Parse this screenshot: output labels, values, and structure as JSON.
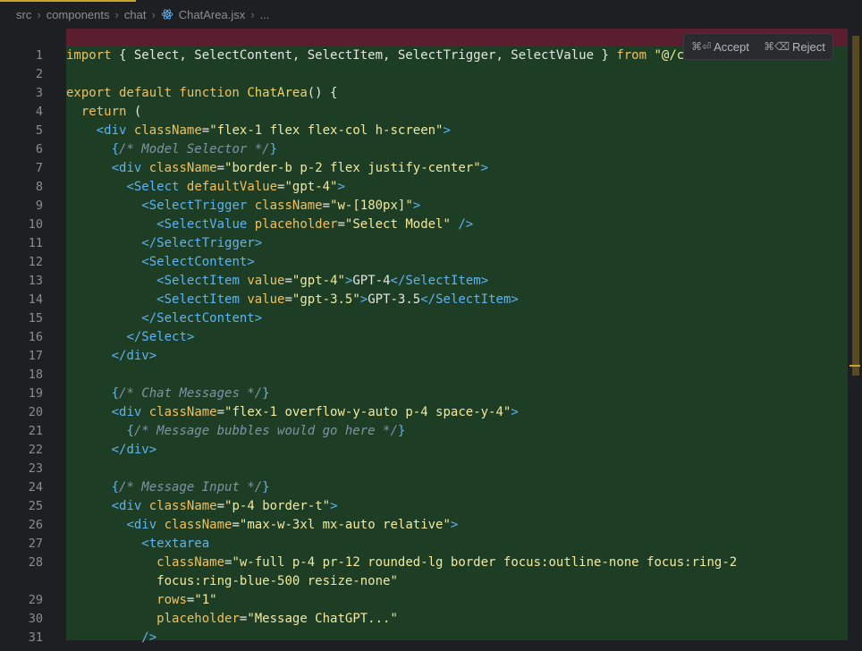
{
  "breadcrumb": {
    "items": [
      "src",
      "components",
      "chat",
      "ChatArea.jsx",
      "..."
    ]
  },
  "diff_actions": {
    "accept_key": "⌘⏎",
    "accept_label": "Accept",
    "reject_key": "⌘⌫",
    "reject_label": "Reject"
  },
  "colors": {
    "added_background": "#1d3d24",
    "deleted_background": "#5a1e2e",
    "keyword": "#f0c060",
    "tag": "#5fb3f0",
    "string": "#f2e9a0",
    "comment": "#7f94a6",
    "accent": "#c9a227"
  },
  "code": {
    "lines": [
      {
        "num": "1",
        "tokens": [
          [
            "kw",
            "import"
          ],
          [
            "txt",
            " { Select, SelectContent, SelectItem, SelectTrigger, SelectValue } "
          ],
          [
            "kw",
            "from"
          ],
          [
            "txt",
            " "
          ],
          [
            "str",
            "\"@/c"
          ]
        ]
      },
      {
        "num": "2",
        "tokens": []
      },
      {
        "num": "3",
        "tokens": [
          [
            "kw",
            "export default function"
          ],
          [
            "txt",
            " "
          ],
          [
            "fn",
            "ChatArea"
          ],
          [
            "txt",
            "() {"
          ]
        ]
      },
      {
        "num": "4",
        "tokens": [
          [
            "txt",
            "  "
          ],
          [
            "kw",
            "return"
          ],
          [
            "txt",
            " ("
          ]
        ]
      },
      {
        "num": "5",
        "tokens": [
          [
            "txt",
            "    "
          ],
          [
            "br",
            "<"
          ],
          [
            "tag",
            "div"
          ],
          [
            "txt",
            " "
          ],
          [
            "attr",
            "className"
          ],
          [
            "txt",
            "="
          ],
          [
            "str",
            "\"flex-1 flex flex-col h-screen\""
          ],
          [
            "br",
            ">"
          ]
        ]
      },
      {
        "num": "6",
        "tokens": [
          [
            "txt",
            "      "
          ],
          [
            "br",
            "{"
          ],
          [
            "cm",
            "/* Model Selector */"
          ],
          [
            "br",
            "}"
          ]
        ]
      },
      {
        "num": "7",
        "tokens": [
          [
            "txt",
            "      "
          ],
          [
            "br",
            "<"
          ],
          [
            "tag",
            "div"
          ],
          [
            "txt",
            " "
          ],
          [
            "attr",
            "className"
          ],
          [
            "txt",
            "="
          ],
          [
            "str",
            "\"border-b p-2 flex justify-center\""
          ],
          [
            "br",
            ">"
          ]
        ]
      },
      {
        "num": "8",
        "tokens": [
          [
            "txt",
            "        "
          ],
          [
            "br",
            "<"
          ],
          [
            "tag",
            "Select"
          ],
          [
            "txt",
            " "
          ],
          [
            "attr",
            "defaultValue"
          ],
          [
            "txt",
            "="
          ],
          [
            "str",
            "\"gpt-4\""
          ],
          [
            "br",
            ">"
          ]
        ]
      },
      {
        "num": "9",
        "tokens": [
          [
            "txt",
            "          "
          ],
          [
            "br",
            "<"
          ],
          [
            "tag",
            "SelectTrigger"
          ],
          [
            "txt",
            " "
          ],
          [
            "attr",
            "className"
          ],
          [
            "txt",
            "="
          ],
          [
            "str",
            "\"w-[180px]\""
          ],
          [
            "br",
            ">"
          ]
        ]
      },
      {
        "num": "10",
        "tokens": [
          [
            "txt",
            "            "
          ],
          [
            "br",
            "<"
          ],
          [
            "tag",
            "SelectValue"
          ],
          [
            "txt",
            " "
          ],
          [
            "attr",
            "placeholder"
          ],
          [
            "txt",
            "="
          ],
          [
            "str",
            "\"Select Model\""
          ],
          [
            "txt",
            " "
          ],
          [
            "br",
            "/>"
          ]
        ]
      },
      {
        "num": "11",
        "tokens": [
          [
            "txt",
            "          "
          ],
          [
            "br",
            "</"
          ],
          [
            "tag",
            "SelectTrigger"
          ],
          [
            "br",
            ">"
          ]
        ]
      },
      {
        "num": "12",
        "tokens": [
          [
            "txt",
            "          "
          ],
          [
            "br",
            "<"
          ],
          [
            "tag",
            "SelectContent"
          ],
          [
            "br",
            ">"
          ]
        ]
      },
      {
        "num": "13",
        "tokens": [
          [
            "txt",
            "            "
          ],
          [
            "br",
            "<"
          ],
          [
            "tag",
            "SelectItem"
          ],
          [
            "txt",
            " "
          ],
          [
            "attr",
            "value"
          ],
          [
            "txt",
            "="
          ],
          [
            "str",
            "\"gpt-4\""
          ],
          [
            "br",
            ">"
          ],
          [
            "txt",
            "GPT-4"
          ],
          [
            "br",
            "</"
          ],
          [
            "tag",
            "SelectItem"
          ],
          [
            "br",
            ">"
          ]
        ]
      },
      {
        "num": "14",
        "tokens": [
          [
            "txt",
            "            "
          ],
          [
            "br",
            "<"
          ],
          [
            "tag",
            "SelectItem"
          ],
          [
            "txt",
            " "
          ],
          [
            "attr",
            "value"
          ],
          [
            "txt",
            "="
          ],
          [
            "str",
            "\"gpt-3.5\""
          ],
          [
            "br",
            ">"
          ],
          [
            "txt",
            "GPT-3.5"
          ],
          [
            "br",
            "</"
          ],
          [
            "tag",
            "SelectItem"
          ],
          [
            "br",
            ">"
          ]
        ]
      },
      {
        "num": "15",
        "tokens": [
          [
            "txt",
            "          "
          ],
          [
            "br",
            "</"
          ],
          [
            "tag",
            "SelectContent"
          ],
          [
            "br",
            ">"
          ]
        ]
      },
      {
        "num": "16",
        "tokens": [
          [
            "txt",
            "        "
          ],
          [
            "br",
            "</"
          ],
          [
            "tag",
            "Select"
          ],
          [
            "br",
            ">"
          ]
        ]
      },
      {
        "num": "17",
        "tokens": [
          [
            "txt",
            "      "
          ],
          [
            "br",
            "</"
          ],
          [
            "tag",
            "div"
          ],
          [
            "br",
            ">"
          ]
        ]
      },
      {
        "num": "18",
        "tokens": []
      },
      {
        "num": "19",
        "tokens": [
          [
            "txt",
            "      "
          ],
          [
            "br",
            "{"
          ],
          [
            "cm",
            "/* Chat Messages */"
          ],
          [
            "br",
            "}"
          ]
        ]
      },
      {
        "num": "20",
        "tokens": [
          [
            "txt",
            "      "
          ],
          [
            "br",
            "<"
          ],
          [
            "tag",
            "div"
          ],
          [
            "txt",
            " "
          ],
          [
            "attr",
            "className"
          ],
          [
            "txt",
            "="
          ],
          [
            "str",
            "\"flex-1 overflow-y-auto p-4 space-y-4\""
          ],
          [
            "br",
            ">"
          ]
        ]
      },
      {
        "num": "21",
        "tokens": [
          [
            "txt",
            "        "
          ],
          [
            "br",
            "{"
          ],
          [
            "cm",
            "/* Message bubbles would go here */"
          ],
          [
            "br",
            "}"
          ]
        ]
      },
      {
        "num": "22",
        "tokens": [
          [
            "txt",
            "      "
          ],
          [
            "br",
            "</"
          ],
          [
            "tag",
            "div"
          ],
          [
            "br",
            ">"
          ]
        ]
      },
      {
        "num": "23",
        "tokens": []
      },
      {
        "num": "24",
        "tokens": [
          [
            "txt",
            "      "
          ],
          [
            "br",
            "{"
          ],
          [
            "cm",
            "/* Message Input */"
          ],
          [
            "br",
            "}"
          ]
        ]
      },
      {
        "num": "25",
        "tokens": [
          [
            "txt",
            "      "
          ],
          [
            "br",
            "<"
          ],
          [
            "tag",
            "div"
          ],
          [
            "txt",
            " "
          ],
          [
            "attr",
            "className"
          ],
          [
            "txt",
            "="
          ],
          [
            "str",
            "\"p-4 border-t\""
          ],
          [
            "br",
            ">"
          ]
        ]
      },
      {
        "num": "26",
        "tokens": [
          [
            "txt",
            "        "
          ],
          [
            "br",
            "<"
          ],
          [
            "tag",
            "div"
          ],
          [
            "txt",
            " "
          ],
          [
            "attr",
            "className"
          ],
          [
            "txt",
            "="
          ],
          [
            "str",
            "\"max-w-3xl mx-auto relative\""
          ],
          [
            "br",
            ">"
          ]
        ]
      },
      {
        "num": "27",
        "tokens": [
          [
            "txt",
            "          "
          ],
          [
            "br",
            "<"
          ],
          [
            "tag",
            "textarea"
          ]
        ]
      },
      {
        "num": "28",
        "tokens": [
          [
            "txt",
            "            "
          ],
          [
            "attr",
            "className"
          ],
          [
            "txt",
            "="
          ],
          [
            "str",
            "\"w-full p-4 pr-12 rounded-lg border focus:outline-none focus:ring-2"
          ]
        ]
      },
      {
        "num": "",
        "tokens": [
          [
            "txt",
            "            "
          ],
          [
            "str",
            "focus:ring-blue-500 resize-none\""
          ]
        ]
      },
      {
        "num": "29",
        "tokens": [
          [
            "txt",
            "            "
          ],
          [
            "attr",
            "rows"
          ],
          [
            "txt",
            "="
          ],
          [
            "str",
            "\"1\""
          ]
        ]
      },
      {
        "num": "30",
        "tokens": [
          [
            "txt",
            "            "
          ],
          [
            "attr",
            "placeholder"
          ],
          [
            "txt",
            "="
          ],
          [
            "str",
            "\"Message ChatGPT...\""
          ]
        ]
      },
      {
        "num": "31",
        "tokens": [
          [
            "txt",
            "          "
          ],
          [
            "br",
            "/>"
          ]
        ]
      }
    ]
  }
}
